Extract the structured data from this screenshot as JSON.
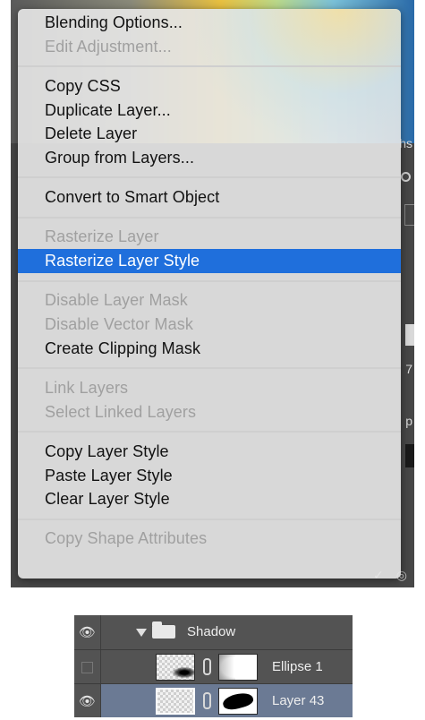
{
  "context_menu": {
    "groups": [
      [
        {
          "label": "Blending Options...",
          "state": "enabled"
        },
        {
          "label": "Edit Adjustment...",
          "state": "disabled"
        }
      ],
      [
        {
          "label": "Copy CSS",
          "state": "enabled"
        },
        {
          "label": "Duplicate Layer...",
          "state": "enabled"
        },
        {
          "label": "Delete Layer",
          "state": "enabled"
        },
        {
          "label": "Group from Layers...",
          "state": "enabled"
        }
      ],
      [
        {
          "label": "Convert to Smart Object",
          "state": "enabled"
        }
      ],
      [
        {
          "label": "Rasterize Layer",
          "state": "disabled"
        },
        {
          "label": "Rasterize Layer Style",
          "state": "selected"
        }
      ],
      [
        {
          "label": "Disable Layer Mask",
          "state": "disabled"
        },
        {
          "label": "Disable Vector Mask",
          "state": "disabled"
        },
        {
          "label": "Create Clipping Mask",
          "state": "enabled"
        }
      ],
      [
        {
          "label": "Link Layers",
          "state": "disabled"
        },
        {
          "label": "Select Linked Layers",
          "state": "disabled"
        }
      ],
      [
        {
          "label": "Copy Layer Style",
          "state": "enabled"
        },
        {
          "label": "Paste Layer Style",
          "state": "enabled"
        },
        {
          "label": "Clear Layer Style",
          "state": "enabled"
        }
      ],
      [
        {
          "label": "Copy Shape Attributes",
          "state": "disabled"
        }
      ]
    ]
  },
  "background_panel": {
    "edge_text_1": "hs",
    "edge_text_2": "7",
    "edge_text_3": "p"
  },
  "layers_panel": {
    "group_name": "Shadow",
    "rows": [
      {
        "name": "Ellipse 1",
        "visible": false,
        "selected": false
      },
      {
        "name": "Layer 43",
        "visible": true,
        "selected": true
      }
    ]
  },
  "colors": {
    "menu_selection": "#1f6fdc",
    "disabled_text": "#a0a0a0",
    "layer_selected_bg": "#6b7a94",
    "layers_bg": "#535353"
  },
  "icons": {
    "eye": "eye-icon",
    "folder": "folder-icon",
    "link": "link-chain-icon",
    "disclosure": "triangle-down-icon"
  }
}
